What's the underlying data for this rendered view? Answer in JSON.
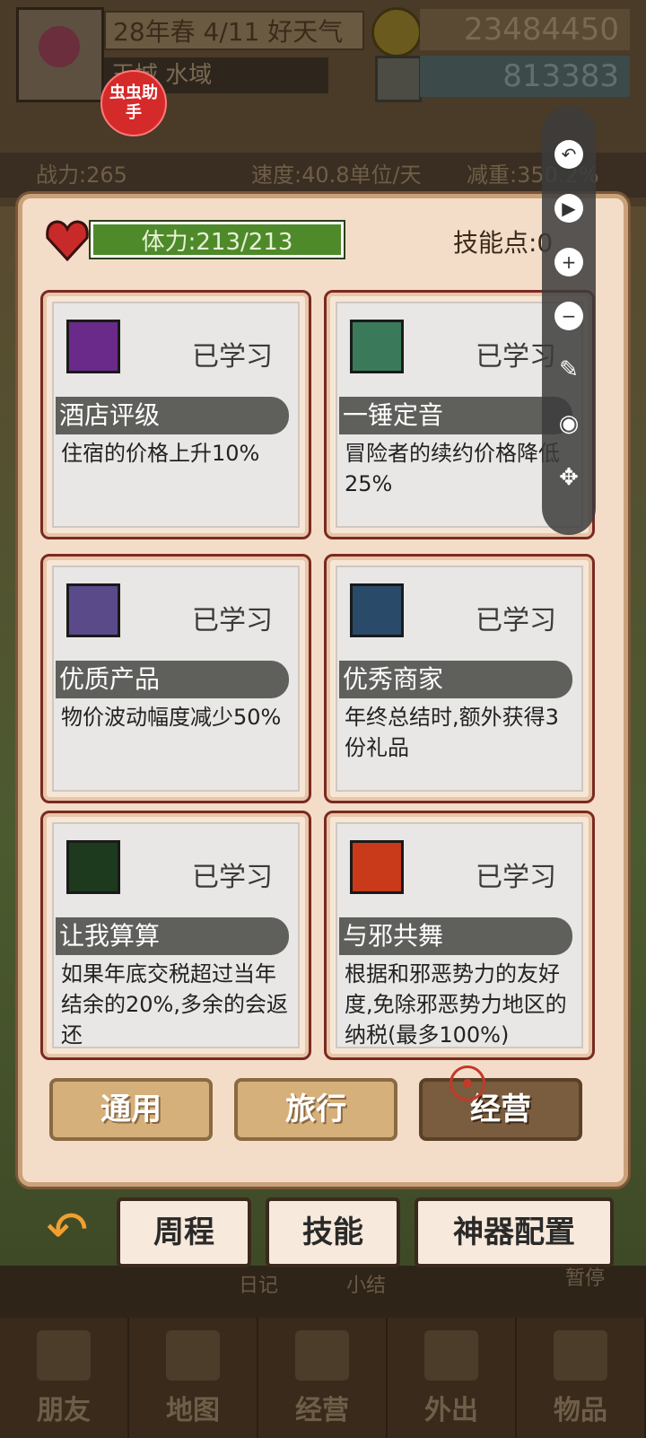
{
  "header": {
    "date": "28年春 4/11 好天气",
    "region": "王城 水域",
    "coins": "23484450",
    "gems": "813383",
    "stats": [
      "战力:265",
      "速度:40.8单位/天",
      "减重:350.2%"
    ]
  },
  "helper_badge": "虫虫助手",
  "panel": {
    "stamina": "体力:213/213",
    "skill_points": "技能点:0",
    "skills": [
      {
        "icon": "hotel-rating-icon",
        "status": "已学习",
        "title": "酒店评级",
        "desc": "住宿的价格上升10%"
      },
      {
        "icon": "hammer-icon",
        "status": "已学习",
        "title": "一锤定音",
        "desc": "冒险者的续约价格降低25%"
      },
      {
        "icon": "quality-product-icon",
        "status": "已学习",
        "title": "优质产品",
        "desc": "物价波动幅度减少50%"
      },
      {
        "icon": "merchant-icon",
        "status": "已学习",
        "title": "优秀商家",
        "desc": "年终总结时,额外获得3份礼品"
      },
      {
        "icon": "calculation-icon",
        "status": "已学习",
        "title": "让我算算",
        "desc": "如果年底交税超过当年结余的20%,多余的会返还"
      },
      {
        "icon": "evil-dance-icon",
        "status": "已学习",
        "title": "与邪共舞",
        "desc": "根据和邪恶势力的友好度,免除邪恶势力地区的纳税(最多100%)"
      }
    ],
    "tabs": [
      "通用",
      "旅行",
      "经营"
    ],
    "active_tab": "经营"
  },
  "sub_tabs": [
    "周程",
    "技能",
    "神器配置"
  ],
  "behind": {
    "diary": "日记",
    "summary": "小结",
    "pause": "暂停"
  },
  "nav": [
    "朋友",
    "地图",
    "经营",
    "外出",
    "物品"
  ],
  "toolbar": [
    "undo",
    "play",
    "zoom-in",
    "zoom-out",
    "edit",
    "eye",
    "move"
  ]
}
